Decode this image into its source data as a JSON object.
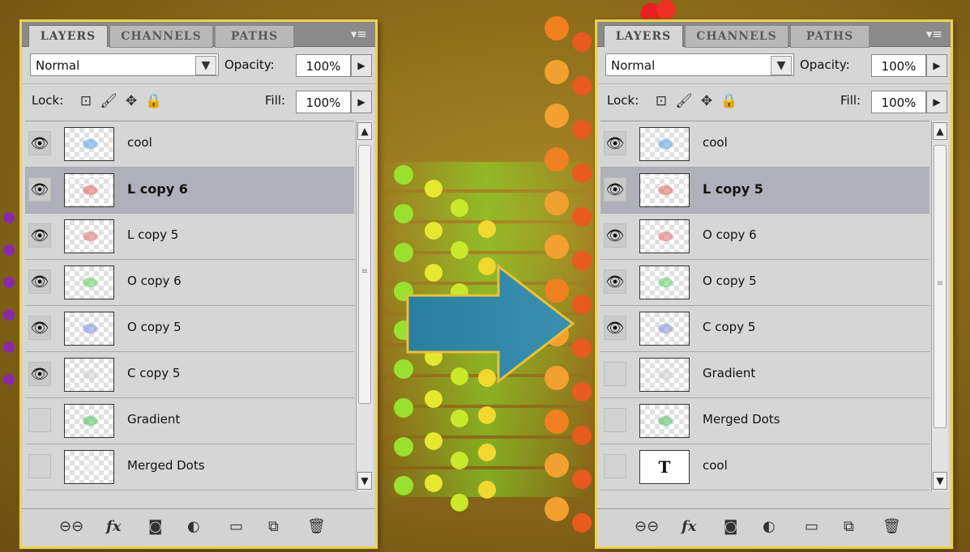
{
  "colors": {
    "panel_border": "#f0d24a",
    "selected_row": "#b0b0ba",
    "background": "#8e6c1a",
    "arrow_fill": "#2a7ea0"
  },
  "left_panel": {
    "tabs": [
      "LAYERS",
      "CHANNELS",
      "PATHS"
    ],
    "blend_mode": "Normal",
    "opacity_label": "Opacity:",
    "opacity_value": "100%",
    "lock_label": "Lock:",
    "fill_label": "Fill:",
    "fill_value": "100%",
    "layers": [
      {
        "name": "cool",
        "visible": true,
        "selected": false
      },
      {
        "name": "L copy 6",
        "visible": true,
        "selected": true
      },
      {
        "name": "L copy 5",
        "visible": true,
        "selected": false
      },
      {
        "name": "O copy 6",
        "visible": true,
        "selected": false
      },
      {
        "name": "O copy 5",
        "visible": true,
        "selected": false
      },
      {
        "name": "C copy 5",
        "visible": true,
        "selected": false
      },
      {
        "name": "Gradient",
        "visible": false,
        "selected": false
      },
      {
        "name": "Merged Dots",
        "visible": false,
        "selected": false
      }
    ]
  },
  "right_panel": {
    "tabs": [
      "LAYERS",
      "CHANNELS",
      "PATHS"
    ],
    "blend_mode": "Normal",
    "opacity_label": "Opacity:",
    "opacity_value": "100%",
    "lock_label": "Lock:",
    "fill_label": "Fill:",
    "fill_value": "100%",
    "layers": [
      {
        "name": "cool",
        "visible": true,
        "selected": false
      },
      {
        "name": "L copy 5",
        "visible": true,
        "selected": true
      },
      {
        "name": "O copy 6",
        "visible": true,
        "selected": false
      },
      {
        "name": "O copy 5",
        "visible": true,
        "selected": false
      },
      {
        "name": "C copy 5",
        "visible": true,
        "selected": false
      },
      {
        "name": "Gradient",
        "visible": false,
        "selected": false
      },
      {
        "name": "Merged Dots",
        "visible": false,
        "selected": false
      },
      {
        "name": "cool",
        "visible": false,
        "selected": false,
        "text_layer": true
      }
    ]
  },
  "icons": {
    "menu": "panel-menu-icon",
    "eye": "eye-icon",
    "lock_transparent": "lock-transparent-icon",
    "lock_paint": "brush-icon",
    "lock_move": "move-icon",
    "lock_all": "padlock-icon",
    "link": "link-icon",
    "fx": "fx-icon",
    "mask": "mask-icon",
    "adjust": "adjustment-icon",
    "group": "folder-icon",
    "new": "new-layer-icon",
    "delete": "trash-icon",
    "text_glyph": "T",
    "fx_label": "fx"
  }
}
